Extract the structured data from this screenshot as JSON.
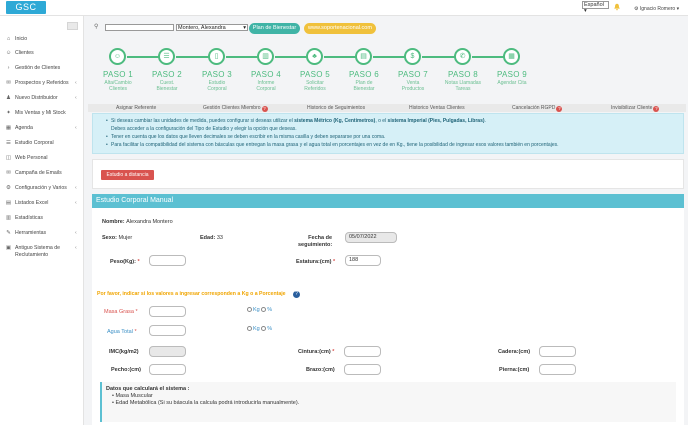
{
  "header": {
    "logo": "GSC",
    "language": "Español",
    "user": "Ignacio Romero"
  },
  "sidebar": {
    "items": [
      {
        "icon": "⌂",
        "label": "Inicio",
        "arrow": ""
      },
      {
        "icon": "☺",
        "label": "Clientes",
        "arrow": ""
      },
      {
        "icon": "›",
        "label": "Gestión de Clientes",
        "arrow": ""
      },
      {
        "icon": "✉",
        "label": "Prospectos y Referidos",
        "arrow": "‹"
      },
      {
        "icon": "♟",
        "label": "Nuevo Distribuidor",
        "arrow": "‹"
      },
      {
        "icon": "✦",
        "label": "Mis Ventas y Mi Stock",
        "arrow": ""
      },
      {
        "icon": "▦",
        "label": "Agenda",
        "arrow": "‹"
      },
      {
        "icon": "☰",
        "label": "Estudio Corporal",
        "arrow": ""
      },
      {
        "icon": "◫",
        "label": "Web Personal",
        "arrow": ""
      },
      {
        "icon": "✉",
        "label": "Campaña de Emails",
        "arrow": ""
      },
      {
        "icon": "⚙",
        "label": "Configuración y Varios",
        "arrow": "‹"
      },
      {
        "icon": "▤",
        "label": "Listados Excel",
        "arrow": "‹"
      },
      {
        "icon": "▥",
        "label": "Estadísticas",
        "arrow": ""
      },
      {
        "icon": "✎",
        "label": "Herramientas",
        "arrow": "‹"
      },
      {
        "icon": "▣",
        "label": "Antiguo Sistema de",
        "label2": "Reclutamiento",
        "arrow": "‹"
      }
    ]
  },
  "search": {
    "selected_client": "Montero, Alexandra",
    "plan_button": "Plan de Bienestar",
    "web_button": "www.soportenacional.com"
  },
  "steps": [
    {
      "icon": "☺",
      "title": "PASO 1",
      "sub1": "Alta/Cambio",
      "sub2": "Clientes"
    },
    {
      "icon": "☰",
      "title": "PASO 2",
      "sub1": "Cuest.",
      "sub2": "Bienestar"
    },
    {
      "icon": "▯",
      "title": "PASO 3",
      "sub1": "Estudio",
      "sub2": "Corporal"
    },
    {
      "icon": "▥",
      "title": "PASO 4",
      "sub1": "Informe",
      "sub2": "Corporal"
    },
    {
      "icon": "♣",
      "title": "PASO 5",
      "sub1": "Solicitar",
      "sub2": "Referidos"
    },
    {
      "icon": "▤",
      "title": "PASO 6",
      "sub1": "Plan de",
      "sub2": "Bienestar"
    },
    {
      "icon": "$",
      "title": "PASO 7",
      "sub1": "Venta",
      "sub2": "Productos"
    },
    {
      "icon": "✆",
      "title": "PASO 8",
      "sub1": "Notas Llamadas",
      "sub2": "Tareas"
    },
    {
      "icon": "▦",
      "title": "PASO 9",
      "sub1": "Agendar Cita",
      "sub2": ""
    }
  ],
  "tabs": [
    {
      "label": "Asignar Referente",
      "help": false
    },
    {
      "label": "Gestión Clientes Miembro",
      "help": true
    },
    {
      "label": "Historico de Seguimientos",
      "help": false
    },
    {
      "label": "Historico Ventas Clientes",
      "help": false
    },
    {
      "label": "Cancelación RGPD",
      "help": true
    },
    {
      "label": "Invisibilizar Cliente",
      "help": true
    }
  ],
  "info": {
    "line1_pre": "Si deseas cambiar las unidades de medida, puedes configurar si deseas utilizar el ",
    "line1_b1": "sistema Métrico (Kg, Centímetros)",
    "line1_mid": ", o el ",
    "line1_b2": "sistema Imperial (Pies, Pulgadas, Libras)",
    "line1_end": ".",
    "line2": "Debes acceder a la configuración del Tipo de Estudio y elegir la opción que deseas.",
    "line3": "Tener en cuenta que los datos que lleven decimales se deben escribir en la misma casilla y deben separarse por una coma.",
    "line4": "Para facilitar la compatibilidad del sistema con básculas que entregan la masa grasa y el agua total en porcentajes en vez de en Kg., tiene la posibilidad de ingresar esos valores también en porcentajes."
  },
  "distance_button": "Estudio a distancia",
  "card": {
    "title": "Estudio Corporal Manual",
    "nombre_label": "Nombre:",
    "nombre_value": "Alexandra Montero",
    "sexo_label": "Sexo:",
    "sexo_value": "Mujer",
    "edad_label": "Edad:",
    "edad_value": "33",
    "fecha_label1": "Fecha de",
    "fecha_label2": "seguimiento:",
    "fecha_value": "05/07/2022",
    "peso_label": "Peso(Kg):",
    "estatura_label": "Estatura:(cm)",
    "estatura_value": "188",
    "percent_note": "Por favor, indicar si los valores a ingresar corresponden a Kg o a Porcentaje",
    "masa_label": "Masa Grasa",
    "agua_label": "Agua Total",
    "kg": "Kg",
    "pct": "%",
    "imc_label": "IMC(kg/m2)",
    "cintura_label": "Cintura:(cm)",
    "cadera_label": "Cadera:(cm)",
    "pecho_label": "Pecho:(cm)",
    "brazo_label": "Brazo:(cm)",
    "pierna_label": "Pierna:(cm)",
    "calc_title": "Datos que calculará el sistema :",
    "calc_1": "Masa Muscular",
    "calc_2": "Edad Metabólica (Si su báscula la calcula podrá introducirla manualmente)."
  },
  "colors": {
    "accent_green": "#4dbb7f",
    "header_blue": "#5cc0d2",
    "danger": "#d9534f"
  }
}
